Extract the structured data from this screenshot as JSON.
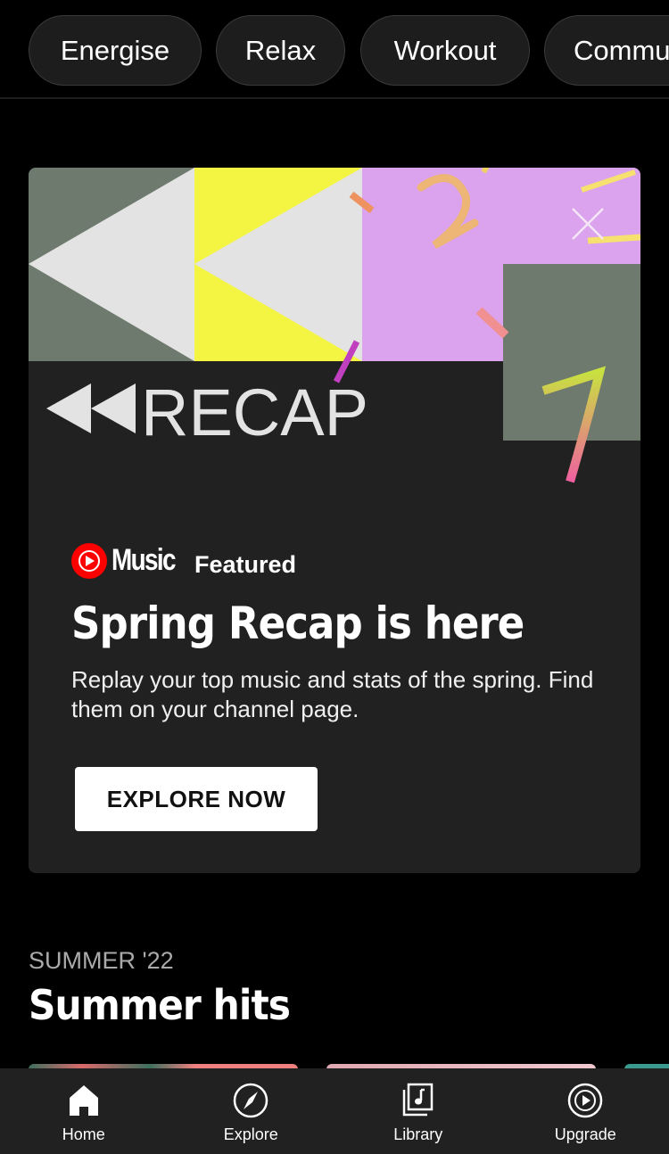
{
  "mood_chips": [
    {
      "label": "Energise"
    },
    {
      "label": "Relax"
    },
    {
      "label": "Workout"
    },
    {
      "label": "Commute"
    }
  ],
  "promo": {
    "art_title": "RECAP",
    "brand": "Music",
    "tag": "Featured",
    "headline": "Spring Recap is here",
    "description": "Replay your top music and stats of the spring. Find them on your channel page.",
    "cta_label": "EXPLORE NOW",
    "close_icon": "close-icon",
    "colors": {
      "card_bg": "#212121",
      "gray": "#6e7a6e",
      "light": "#e3e3e3",
      "yellow": "#f4f442",
      "lilac": "#dba2ee",
      "brand_red": "#ff0000"
    }
  },
  "section": {
    "kicker": "SUMMER '22",
    "title": "Summer hits"
  },
  "bottom_nav": [
    {
      "label": "Home",
      "icon": "home-icon",
      "active": true
    },
    {
      "label": "Explore",
      "icon": "compass-icon",
      "active": false
    },
    {
      "label": "Library",
      "icon": "library-icon",
      "active": false
    },
    {
      "label": "Upgrade",
      "icon": "upgrade-icon",
      "active": false
    }
  ]
}
